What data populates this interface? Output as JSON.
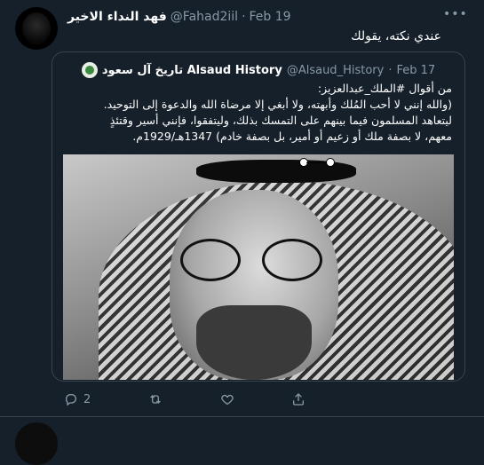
{
  "tweet": {
    "author_name": "فهد النداء الاخير",
    "handle": "@Fahad2iil",
    "separator": "·",
    "date": "Feb 19",
    "text": "عندي نكته، يقولك",
    "more_icon": "more-horizontal-icon"
  },
  "quote": {
    "author_name": "تاريخ آل سعود Alsaud History",
    "handle": "@Alsaud_History",
    "separator": "·",
    "date": "Feb 17",
    "lines": [
      "من أقوال #الملك_عبدالعزيز:",
      "(والله إنني لا أحب المُلك وأبهته، ولا أبغي إلا مرضاة الله والدعوة إلى التوحيد.",
      "ليتعاهد المسلمون فيما بينهم على التمسك بذلك، وليتفقوا، فإنني أسير وقتئذٍ",
      "معهم، لا بصفة ملك أو زعيم أو أمير، بل بصفة خادم) 1347هـ/1929م."
    ],
    "photo_alt": "portrait-photo"
  },
  "actions": {
    "reply_icon": "reply-icon",
    "reply_count": "2",
    "retweet_icon": "retweet-icon",
    "like_icon": "like-icon",
    "share_icon": "share-icon"
  },
  "colors": {
    "background": "#15202b",
    "muted": "#8899a6",
    "border": "#38444d"
  }
}
